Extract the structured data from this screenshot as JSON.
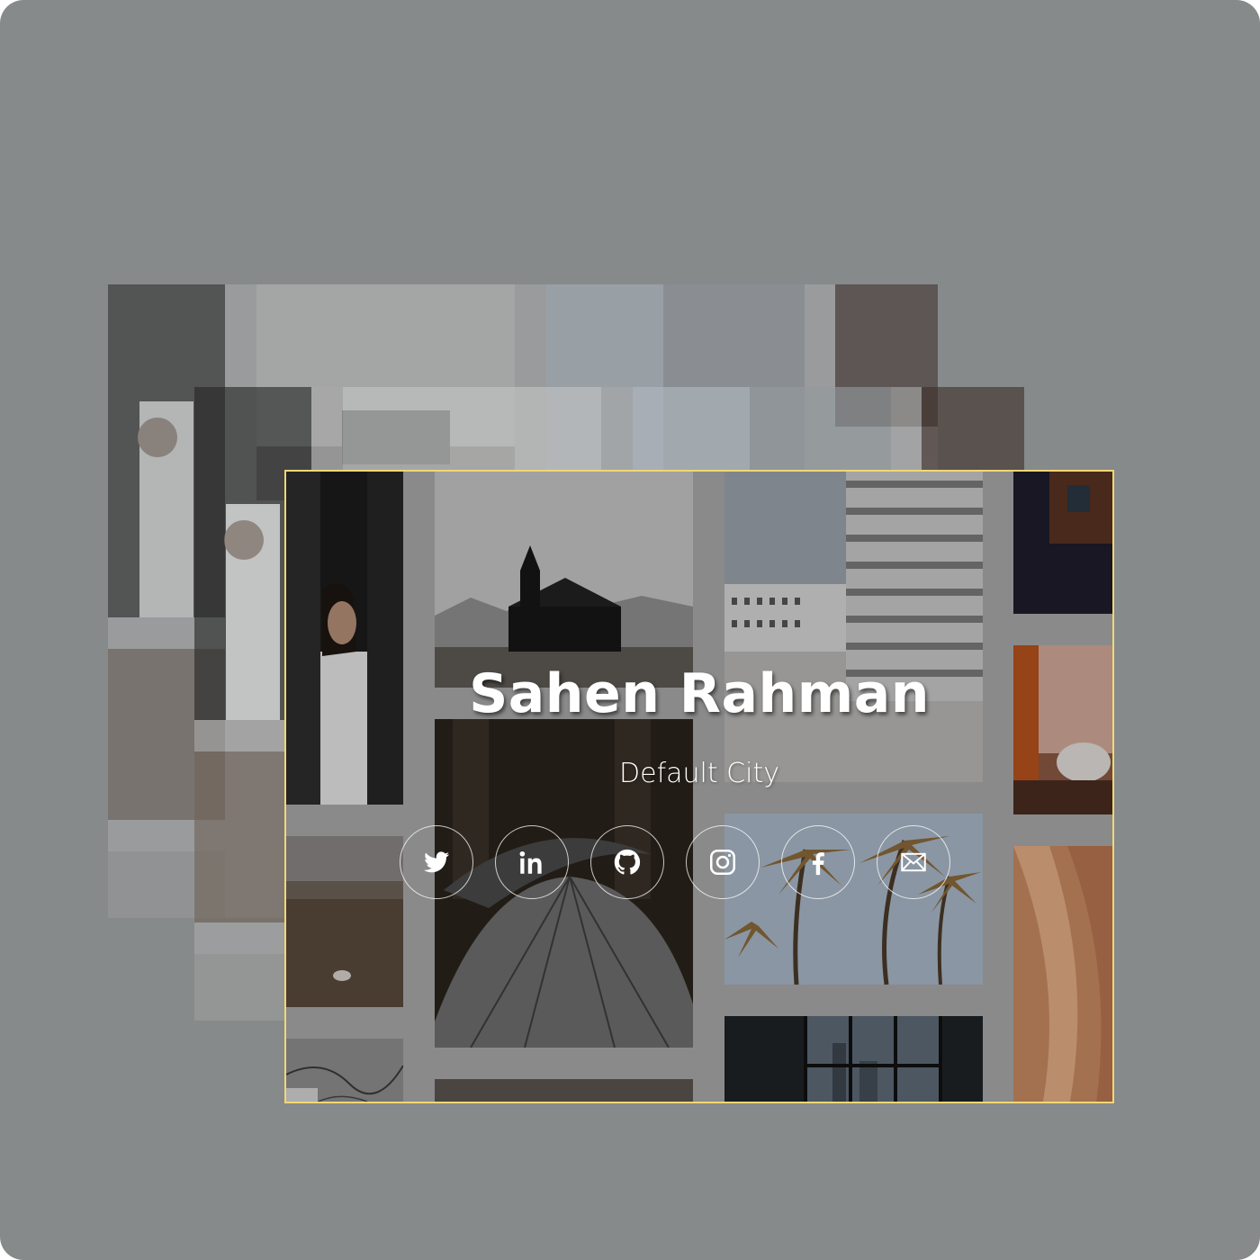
{
  "profile": {
    "name": "Sahen Rahman",
    "city": "Default City"
  },
  "social_links": [
    {
      "name": "twitter",
      "icon": "twitter-icon"
    },
    {
      "name": "linkedin",
      "icon": "linkedin-icon"
    },
    {
      "name": "github",
      "icon": "github-icon"
    },
    {
      "name": "instagram",
      "icon": "instagram-icon"
    },
    {
      "name": "facebook",
      "icon": "facebook-icon"
    },
    {
      "name": "email",
      "icon": "mail-icon"
    }
  ],
  "colors": {
    "background": "#878a8b",
    "tile_gap": "#a9a9aa",
    "highlight_border": "#f1d774",
    "text": "#ffffff"
  }
}
